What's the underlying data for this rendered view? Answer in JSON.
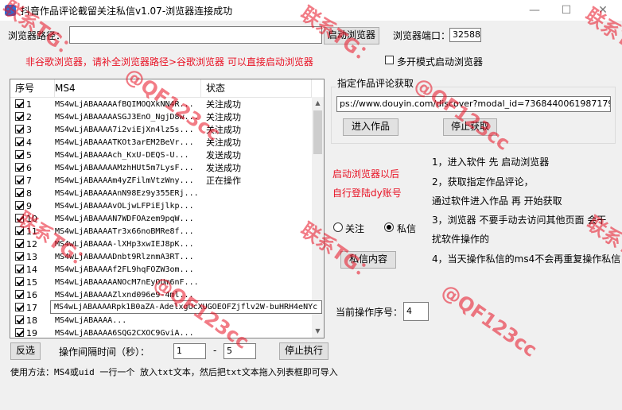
{
  "window": {
    "title": "抖音作品评论截留关注私信v1.07-浏览器连接成功",
    "minimize_glyph": "—",
    "maximize_glyph": "☐",
    "close_glyph": "✕"
  },
  "browser": {
    "path_label": "浏览器路径：",
    "path_value": "",
    "start_button": "启动浏览器",
    "port_label": "浏览器端口：",
    "port_value": "32588",
    "hint": "非谷歌浏览器，请补全浏览器路径>谷歌浏览器 可以直接启动浏览器",
    "multi_label": "多开模式启动浏览器"
  },
  "table": {
    "headers": [
      "序号",
      "MS4",
      "状态"
    ],
    "rows": [
      {
        "no": "1",
        "ms4": "MS4wLjABAAAAAfBQIMOQXkNN4R...",
        "status": "关注成功"
      },
      {
        "no": "2",
        "ms4": "MS4wLjABAAAAASGJ3EnO_NgjD8w...",
        "status": "关注成功"
      },
      {
        "no": "3",
        "ms4": "MS4wLjABAAAA7i2viEjXn4lz5s...",
        "status": "关注成功"
      },
      {
        "no": "4",
        "ms4": "MS4wLjABAAAATKOt3arEM2BeVr...",
        "status": "关注成功"
      },
      {
        "no": "5",
        "ms4": "MS4wLjABAAAAch_KxU-DEQS-U...",
        "status": "发送成功"
      },
      {
        "no": "6",
        "ms4": "MS4wLjABAAAAAMzhHUt5m7LysF...",
        "status": "发送成功"
      },
      {
        "no": "7",
        "ms4": "MS4wLjABAAAAm4yZFilmVtzWny...",
        "status": "正在操作"
      },
      {
        "no": "8",
        "ms4": "MS4wLjABAAAAAnN98Ez9y355ERj...",
        "status": ""
      },
      {
        "no": "9",
        "ms4": "MS4wLjABAAAAvOLjwLFPiEjlkp...",
        "status": ""
      },
      {
        "no": "10",
        "ms4": "MS4wLjABAAAAN7WDFOAzem9pqW...",
        "status": ""
      },
      {
        "no": "11",
        "ms4": "MS4wLjABAAAATr3x66noBMRe8f...",
        "status": ""
      },
      {
        "no": "12",
        "ms4": "MS4wLjABAAAA-lXHp3xwIEJ8pK...",
        "status": ""
      },
      {
        "no": "13",
        "ms4": "MS4wLjABAAAADnbt9RlznmA3RT...",
        "status": ""
      },
      {
        "no": "14",
        "ms4": "MS4wLjABAAAAf2FL9hqFOZW3om...",
        "status": ""
      },
      {
        "no": "15",
        "ms4": "MS4wLjABAAAAANOcM7nEyOUm6nF...",
        "status": ""
      },
      {
        "no": "16",
        "ms4": "MS4wLjABAAAAZlxnd096e9-4ml...",
        "status": ""
      },
      {
        "no": "17",
        "ms4": "MS4wLjABAAAARpk1B0aZA-AdelxgUcXUGOEOFZjflv2W-buHRH4eNYc",
        "status": ""
      },
      {
        "no": "18",
        "ms4": "MS4wLjABAAAA...",
        "status": ""
      },
      {
        "no": "19",
        "ms4": "MS4wLjABAAAA6SQG2CXOC9GviA...",
        "status": ""
      },
      {
        "no": "20",
        "ms4": "MS4wLjABAAAAOnxs0tLeOLnLcO...",
        "status": ""
      }
    ],
    "tooltip": "MS4wLjABAAAARpk1B0aZA-AdelxgUcXUGOEOFZjflv2W-buHRH4eNYc"
  },
  "comments": {
    "group_title": "指定作品评论获取",
    "url_value": "ps://www.douyin.com/discover?modal_id=7368440061987179776",
    "enter_button": "进入作品",
    "stop_button": "停止获取"
  },
  "notes": {
    "login_line1": "启动浏览器以后",
    "login_line2": "自行登陆dy账号",
    "step1": "1，进入软件 先 启动浏览器",
    "step2a": "2，获取指定作品评论，",
    "step2b": "通过软件进入作品 再 开始获取",
    "step3a": "3，浏览器 不要手动去访问其他页面 会干",
    "step3b": "扰软件操作的",
    "step4": "4，当天操作私信的ms4不会再重复操作私信"
  },
  "mode": {
    "follow_label": "关注",
    "message_label": "私信",
    "message_content_button": "私信内容"
  },
  "current": {
    "label": "当前操作序号：",
    "value": "4"
  },
  "footer": {
    "invert_button": "反选",
    "interval_label": "操作间隔时间（秒）：",
    "interval_min": "1",
    "interval_sep": "-",
    "interval_max": "5",
    "stop_button": "停止执行",
    "usage": "使用方法：MS4或uid 一行一个 放入txt文本，然后把txt文本拖入列表框即可导入"
  },
  "watermark": {
    "text1": "联系TG：",
    "text2": "@QF123cc"
  }
}
